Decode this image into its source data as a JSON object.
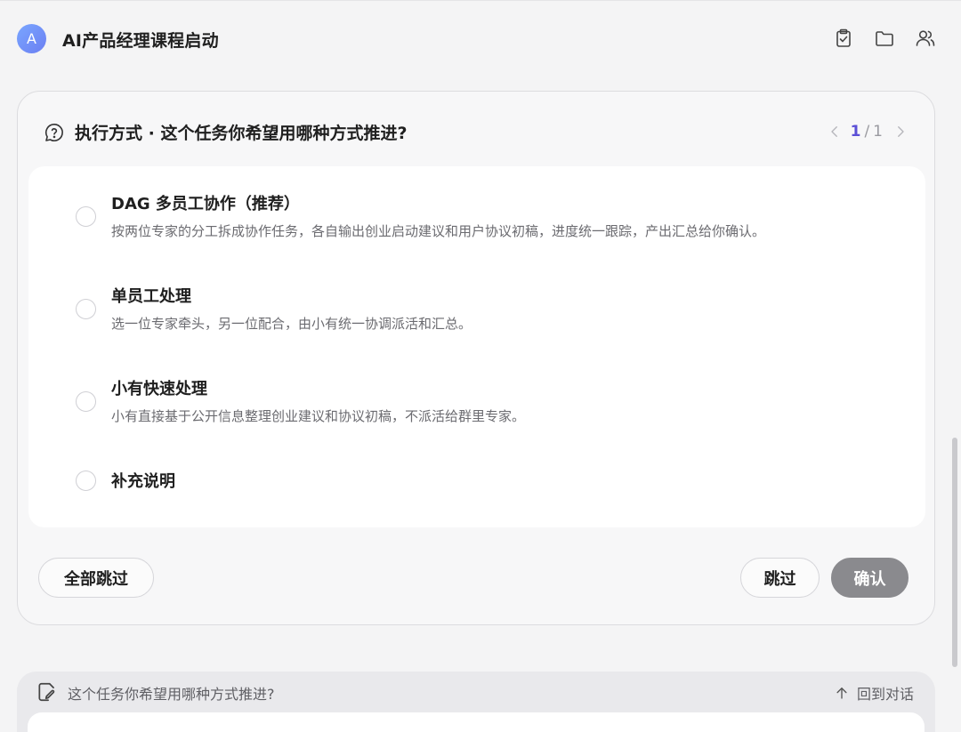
{
  "header": {
    "avatar_letter": "A",
    "title": "AI产品经理课程启动",
    "icons": [
      "clipboard-check-icon",
      "folder-icon",
      "users-icon"
    ]
  },
  "question_card": {
    "icon": "question-bubble-icon",
    "title": "执行方式 · 这个任务你希望用哪种方式推进?",
    "pager": {
      "current": "1",
      "separator": "/",
      "total": "1"
    },
    "options": [
      {
        "title": "DAG 多员工协作（推荐）",
        "description": "按两位专家的分工拆成协作任务，各自输出创业启动建议和用户协议初稿，进度统一跟踪，产出汇总给你确认。",
        "selected": false
      },
      {
        "title": "单员工处理",
        "description": "选一位专家牵头，另一位配合，由小有统一协调派活和汇总。",
        "selected": false
      },
      {
        "title": "小有快速处理",
        "description": "小有直接基于公开信息整理创业建议和协议初稿，不派活给群里专家。",
        "selected": false
      },
      {
        "title": "补充说明",
        "description": "",
        "selected": false
      }
    ],
    "buttons": {
      "skip_all": "全部跳过",
      "skip": "跳过",
      "confirm": "确认"
    }
  },
  "composer": {
    "hint": "这个任务你希望用哪种方式推进?",
    "back_label": "回到对话"
  },
  "colors": {
    "accent": "#5b4fd6",
    "avatar_gradient_start": "#7aa6ff",
    "avatar_gradient_end": "#6b7ff2",
    "confirm_disabled": "#8a8a8e"
  }
}
